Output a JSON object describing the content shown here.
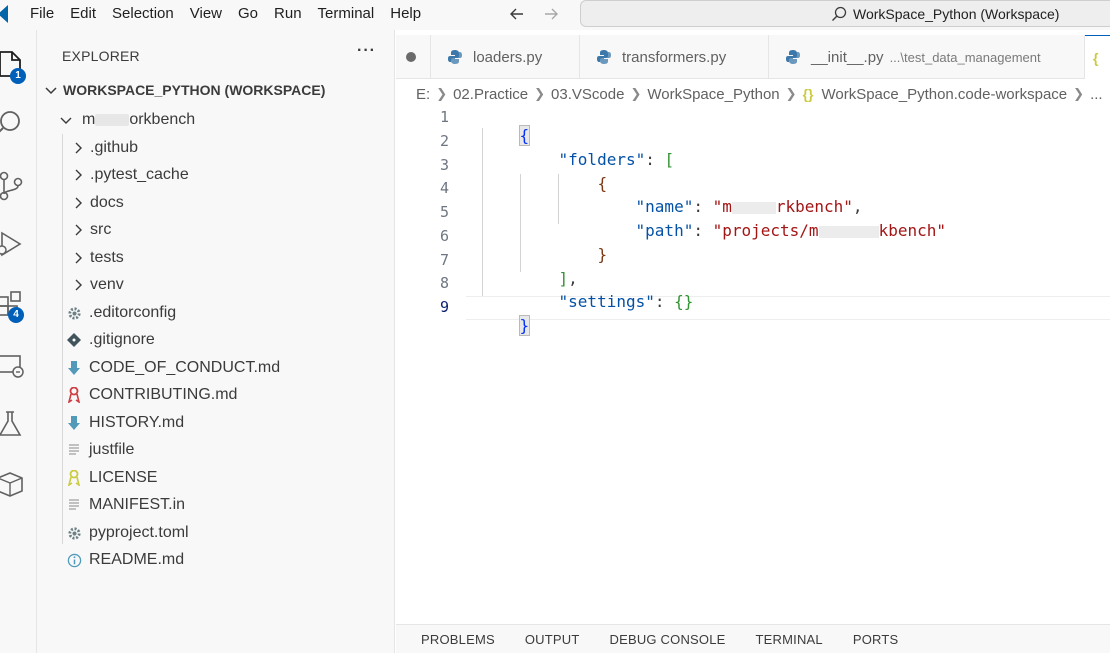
{
  "menu": [
    "File",
    "Edit",
    "Selection",
    "View",
    "Go",
    "Run",
    "Terminal",
    "Help"
  ],
  "command_center": {
    "label": "WorkSpace_Python (Workspace)"
  },
  "activity": {
    "explorer_badge": "1",
    "extensions_badge": "4"
  },
  "sidebar": {
    "header": "EXPLORER",
    "more": "···",
    "workspace_title": "WORKSPACE_PYTHON (WORKSPACE)",
    "project_prefix": "m",
    "project_suffix": "orkbench",
    "items": [
      {
        "label": ".github",
        "kind": "folder"
      },
      {
        "label": ".pytest_cache",
        "kind": "folder"
      },
      {
        "label": "docs",
        "kind": "folder"
      },
      {
        "label": "src",
        "kind": "folder"
      },
      {
        "label": "tests",
        "kind": "folder"
      },
      {
        "label": "venv",
        "kind": "folder"
      },
      {
        "label": ".editorconfig",
        "kind": "gear-icon"
      },
      {
        "label": ".gitignore",
        "kind": "git-icon"
      },
      {
        "label": "CODE_OF_CONDUCT.md",
        "kind": "markdown-icon"
      },
      {
        "label": "CONTRIBUTING.md",
        "kind": "ribbon-icon"
      },
      {
        "label": "HISTORY.md",
        "kind": "markdown-icon"
      },
      {
        "label": "justfile",
        "kind": "text-file-icon"
      },
      {
        "label": "LICENSE",
        "kind": "license-icon"
      },
      {
        "label": "MANIFEST.in",
        "kind": "text-file-icon"
      },
      {
        "label": "pyproject.toml",
        "kind": "gear-icon"
      },
      {
        "label": "README.md",
        "kind": "info-icon"
      }
    ]
  },
  "tabs": [
    {
      "label": "loaders.py"
    },
    {
      "label": "transformers.py"
    },
    {
      "label": "__init__.py",
      "detail": "...\\test_data_management"
    }
  ],
  "breadcrumb": [
    "E:",
    "02.Practice",
    "03.VScode",
    "WorkSpace_Python",
    "WorkSpace_Python.code-workspace",
    "..."
  ],
  "editor": {
    "line_numbers": [
      "1",
      "2",
      "3",
      "4",
      "5",
      "6",
      "7",
      "8",
      "9"
    ],
    "active_line": "9",
    "code": {
      "l1_brace": "{",
      "l2_key": "\"folders\"",
      "l2_colon": ": ",
      "l2_bracket": "[",
      "l3_brace": "{",
      "l4_key": "\"name\"",
      "l4_colon": ": ",
      "l4_val_start": "\"m",
      "l4_val_end": "rkbench\"",
      "l4_comma": ",",
      "l5_key": "\"path\"",
      "l5_colon": ": ",
      "l5_val_start": "\"projects/m",
      "l5_val_end": "kbench\"",
      "l6_brace": "}",
      "l7_bracket": "]",
      "l7_comma": ",",
      "l8_key": "\"settings\"",
      "l8_colon": ": ",
      "l8_braces": "{}",
      "l9_brace": "}"
    }
  },
  "panel_tabs": [
    "PROBLEMS",
    "OUTPUT",
    "DEBUG CONSOLE",
    "TERMINAL",
    "PORTS"
  ]
}
